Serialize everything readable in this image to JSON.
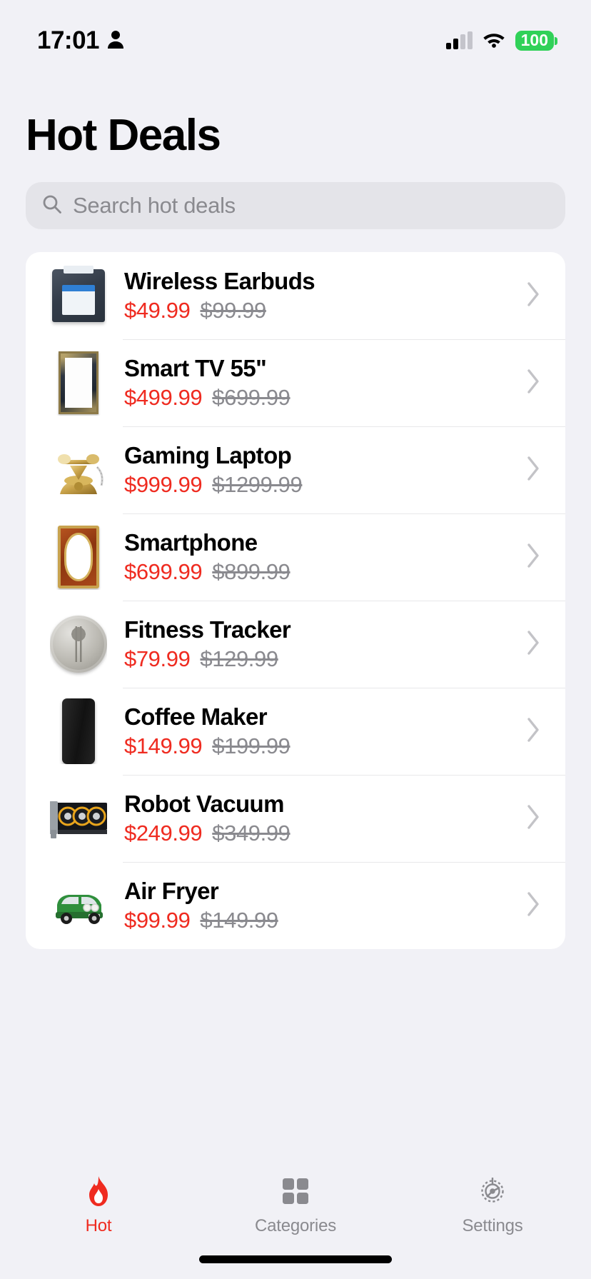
{
  "status_bar": {
    "time": "17:01",
    "person_icon": "person-icon",
    "signal_icon": "cellular-signal-icon",
    "wifi_icon": "wifi-icon",
    "battery_level": "100"
  },
  "header": {
    "title": "Hot Deals"
  },
  "search": {
    "icon": "search-icon",
    "placeholder": "Search hot deals",
    "value": ""
  },
  "deals": [
    {
      "name": "Wireless Earbuds",
      "sale_price": "$49.99",
      "original_price": "$99.99",
      "thumb": "art-device",
      "thumb_name": "product-thumbnail-wireless-earbuds"
    },
    {
      "name": "Smart TV 55\"",
      "sale_price": "$499.99",
      "original_price": "$699.99",
      "thumb": "art-frame-dark",
      "thumb_name": "product-thumbnail-smart-tv"
    },
    {
      "name": "Gaming Laptop",
      "sale_price": "$999.99",
      "original_price": "$1299.99",
      "thumb": "art-phone",
      "thumb_name": "product-thumbnail-gaming-laptop"
    },
    {
      "name": "Smartphone",
      "sale_price": "$699.99",
      "original_price": "$899.99",
      "thumb": "art-frame-red",
      "thumb_name": "product-thumbnail-smartphone"
    },
    {
      "name": "Fitness Tracker",
      "sale_price": "$79.99",
      "original_price": "$129.99",
      "thumb": "art-coin",
      "thumb_name": "product-thumbnail-fitness-tracker"
    },
    {
      "name": "Coffee Maker",
      "sale_price": "$149.99",
      "original_price": "$199.99",
      "thumb": "art-slab",
      "thumb_name": "product-thumbnail-coffee-maker"
    },
    {
      "name": "Robot Vacuum",
      "sale_price": "$249.99",
      "original_price": "$349.99",
      "thumb": "art-gpu",
      "thumb_name": "product-thumbnail-robot-vacuum"
    },
    {
      "name": "Air Fryer",
      "sale_price": "$99.99",
      "original_price": "$149.99",
      "thumb": "art-car",
      "thumb_name": "product-thumbnail-air-fryer"
    }
  ],
  "tabs": [
    {
      "label": "Hot",
      "icon": "flame-icon",
      "active": true
    },
    {
      "label": "Categories",
      "icon": "grid-icon",
      "active": false
    },
    {
      "label": "Settings",
      "icon": "gear-icon",
      "active": false
    }
  ],
  "colors": {
    "accent_red": "#ef2b20",
    "sale_price": "#ef2b20",
    "original_price": "#8a8a8f",
    "background": "#f1f1f6",
    "card": "#ffffff",
    "battery_green": "#30d158"
  }
}
